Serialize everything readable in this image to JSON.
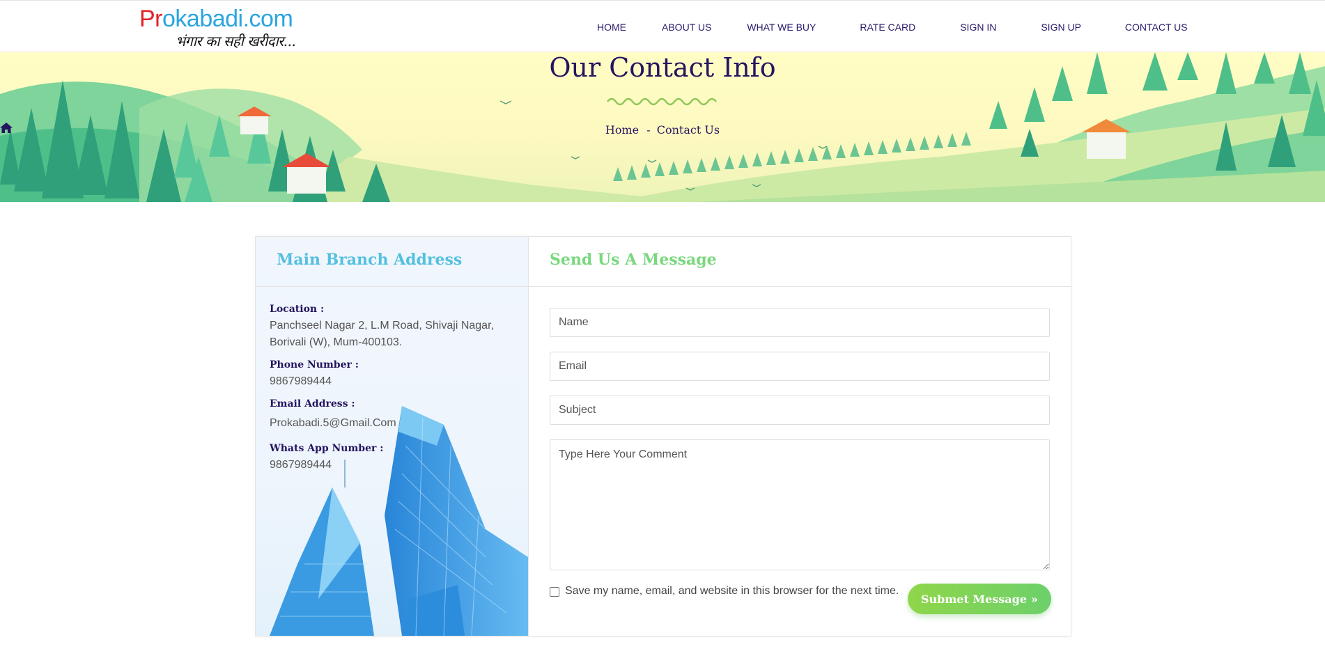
{
  "nav": {
    "logo_text": "Prokabadi.com",
    "logo_tagline": "भंगार का सही खरीदार...",
    "items": [
      "HOME",
      "ABOUT US",
      "WHAT WE BUY",
      "RATE CARD",
      "SIGN IN",
      "SIGN UP",
      "CONTACT US"
    ]
  },
  "hero": {
    "title": "Our Contact Info",
    "breadcrumb_home": "Home",
    "breadcrumb_sep": "-",
    "breadcrumb_current": "Contact Us"
  },
  "address": {
    "heading": "Main Branch Address",
    "location_label": "Location :",
    "location_line1": "Panchseel Nagar 2, L.M Road, Shivaji Nagar,",
    "location_line2": "Borivali (W), Mum-400103.",
    "phone_label": "Phone Number :",
    "phone": "9867989444",
    "email_label": "Email Address :",
    "email": "Prokabadi.5@Gmail.Com",
    "whatsapp_label": "Whats App Number :",
    "whatsapp": "9867989444"
  },
  "form": {
    "heading": "Send Us A Message",
    "name_placeholder": "Name",
    "email_placeholder": "Email",
    "subject_placeholder": "Subject",
    "comment_placeholder": "Type Here Your Comment",
    "save_label": "Save my name, email, and website in this browser for the next time.",
    "submit_label": "Submet Message"
  },
  "colors": {
    "nav_text": "#2b1a6b",
    "address_heading": "#55c0e0",
    "form_heading": "#79d87e",
    "button": "#7dd35a"
  }
}
